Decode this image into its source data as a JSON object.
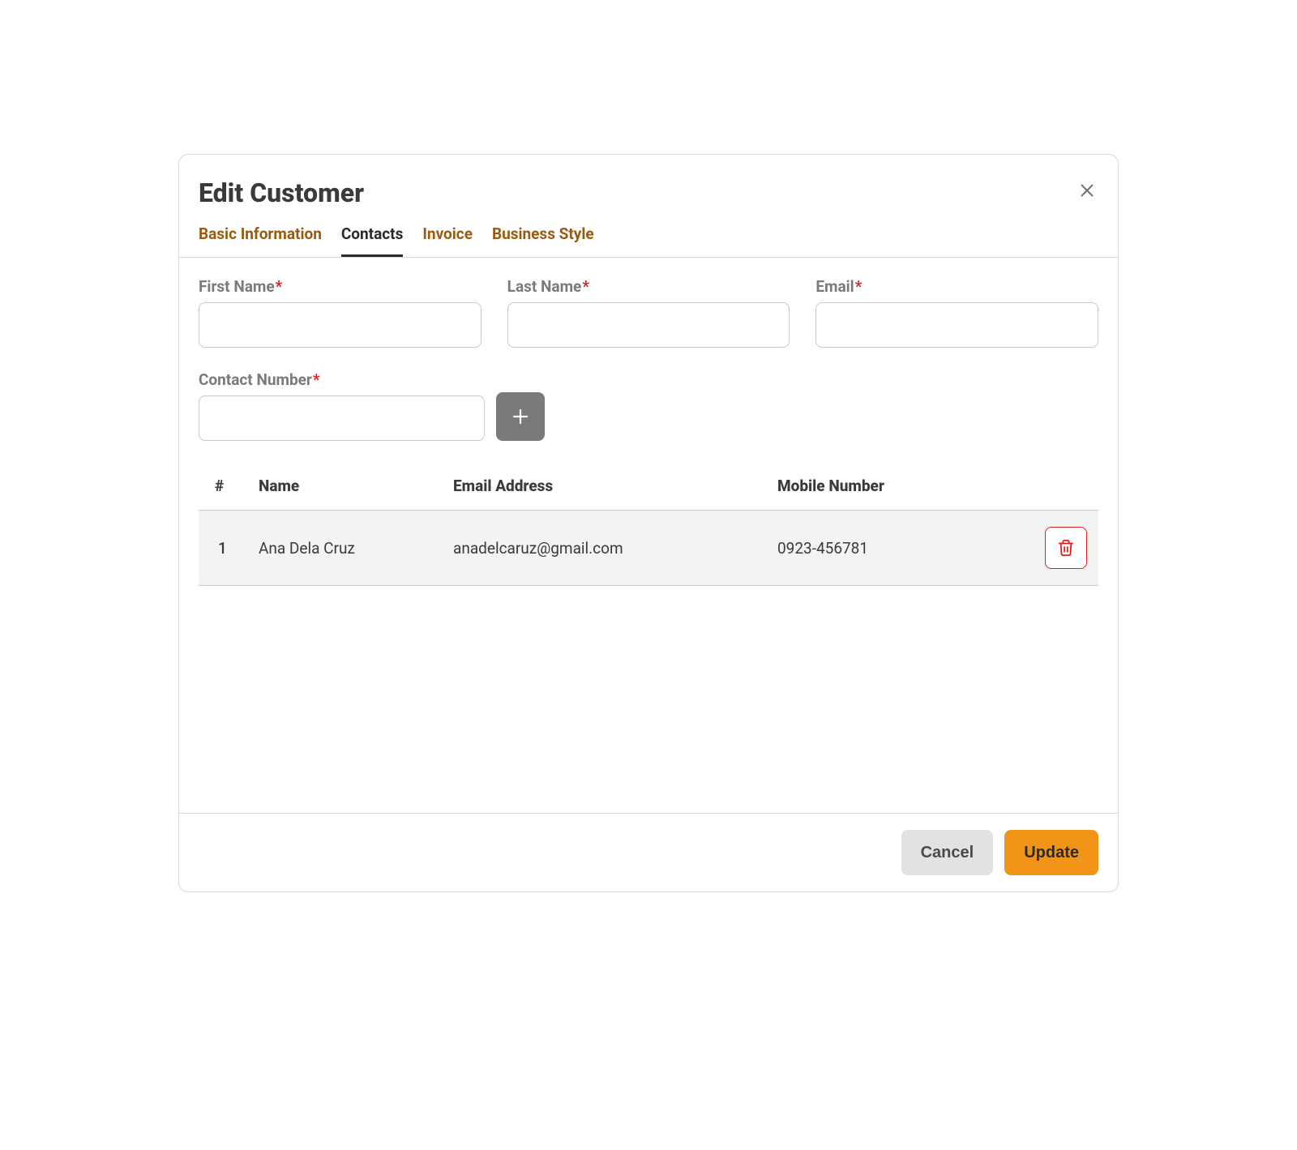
{
  "modal": {
    "title": "Edit Customer"
  },
  "tabs": [
    {
      "label": "Basic Information",
      "active": false
    },
    {
      "label": "Contacts",
      "active": true
    },
    {
      "label": "Invoice",
      "active": false
    },
    {
      "label": "Business Style",
      "active": false
    }
  ],
  "form": {
    "first_name_label": "First Name",
    "first_name_value": "",
    "last_name_label": "Last Name",
    "last_name_value": "",
    "email_label": "Email",
    "email_value": "",
    "contact_number_label": "Contact Number",
    "contact_number_value": "",
    "required_mark": "*"
  },
  "table": {
    "headers": {
      "num": "#",
      "name": "Name",
      "email": "Email Address",
      "mobile": "Mobile Number"
    },
    "rows": [
      {
        "num": "1",
        "name": "Ana Dela Cruz",
        "email": "anadelcaruz@gmail.com",
        "mobile": "0923-456781"
      }
    ]
  },
  "footer": {
    "cancel": "Cancel",
    "update": "Update"
  },
  "colors": {
    "accent_brown": "#9a5b0f",
    "danger": "#e02020",
    "primary": "#f29418"
  }
}
